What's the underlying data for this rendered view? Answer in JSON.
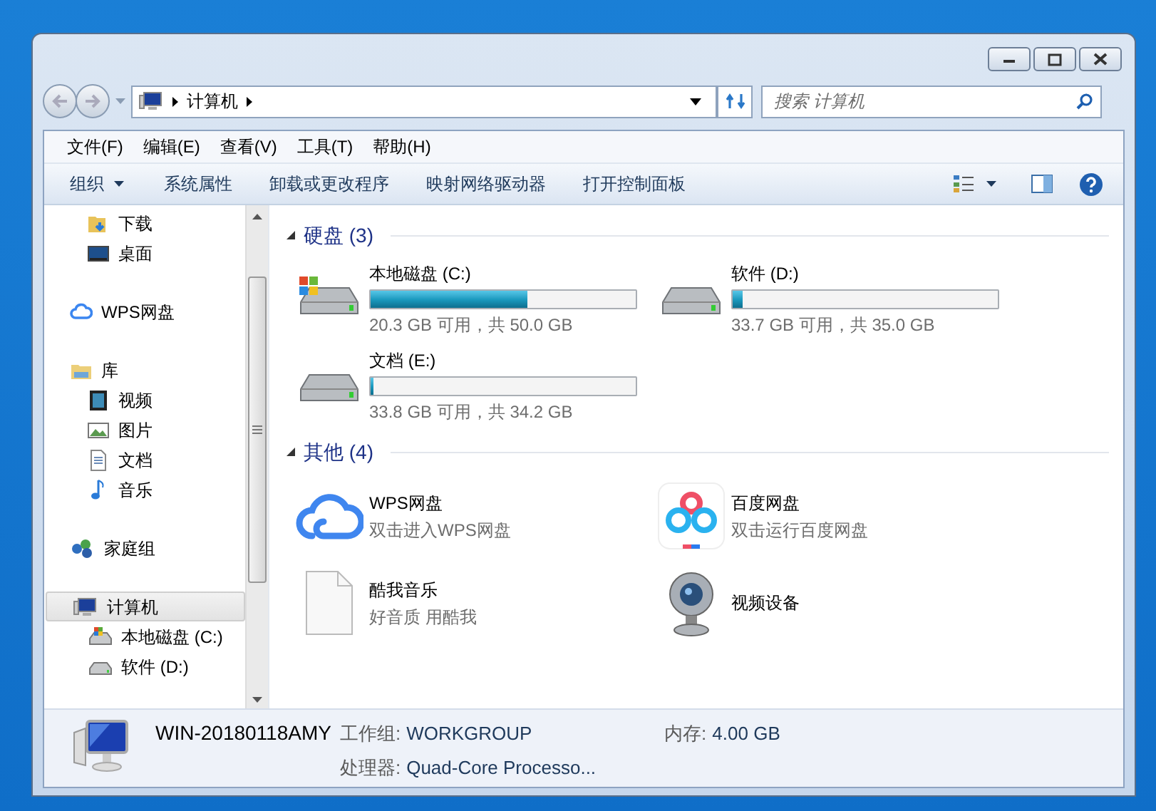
{
  "window": {
    "caption_buttons": [
      {
        "kind": "minimize"
      },
      {
        "kind": "maximize"
      },
      {
        "kind": "close"
      }
    ]
  },
  "navigation": {
    "address": [
      "计算机"
    ],
    "search": {
      "placeholder": "搜索 计算机"
    }
  },
  "menu": [
    "文件(F)",
    "编辑(E)",
    "查看(V)",
    "工具(T)",
    "帮助(H)"
  ],
  "toolbar": [
    {
      "label": "组织",
      "dropdown": true
    },
    {
      "label": "系统属性",
      "dropdown": false
    },
    {
      "label": "卸载或更改程序",
      "dropdown": false
    },
    {
      "label": "映射网络驱动器",
      "dropdown": false
    },
    {
      "label": "打开控制面板",
      "dropdown": false
    }
  ],
  "sidebar": [
    {
      "items": [
        {
          "label": "下载",
          "kind": "download",
          "selected": false
        },
        {
          "label": "桌面",
          "kind": "desktop",
          "selected": false
        }
      ]
    },
    {
      "head": {
        "label": "WPS网盘",
        "kind": "cloud",
        "selected": false
      }
    },
    {
      "head": {
        "label": "库",
        "kind": "library",
        "selected": false
      },
      "items": [
        {
          "label": "视频",
          "kind": "video",
          "selected": false
        },
        {
          "label": "图片",
          "kind": "picture",
          "selected": false
        },
        {
          "label": "文档",
          "kind": "document",
          "selected": false
        },
        {
          "label": "音乐",
          "kind": "music",
          "selected": false
        }
      ]
    },
    {
      "head": {
        "label": "家庭组",
        "kind": "homegroup",
        "selected": false
      }
    },
    {
      "head": {
        "label": "计算机",
        "kind": "computer",
        "selected": true
      },
      "items": [
        {
          "label": "本地磁盘 (C:)",
          "kind": "system-drive",
          "selected": false
        },
        {
          "label": "软件 (D:)",
          "kind": "drive",
          "selected": false
        }
      ]
    }
  ],
  "groups": [
    {
      "title": "硬盘 (3)",
      "expanded": true,
      "kind": "drives",
      "items": [
        {
          "name": "本地磁盘 (C:)",
          "kind": "system-drive",
          "level": 0.594,
          "free": "20.3 GB 可用，共 50.0 GB"
        },
        {
          "name": "软件 (D:)",
          "kind": "drive",
          "level": 0.037,
          "free": "33.7 GB 可用，共 35.0 GB"
        },
        {
          "name": "文档 (E:)",
          "kind": "drive",
          "level": 0.012,
          "free": "33.8 GB 可用，共 34.2 GB"
        }
      ]
    },
    {
      "title": "其他 (4)",
      "expanded": true,
      "kind": "others",
      "items": [
        {
          "name": "WPS网盘",
          "kind": "cloud",
          "subtitle": "双击进入WPS网盘"
        },
        {
          "name": "百度网盘",
          "kind": "baidu",
          "subtitle": "双击运行百度网盘"
        },
        {
          "name": "酷我音乐",
          "kind": "file",
          "subtitle": "好音质 用酷我"
        },
        {
          "name": "视频设备",
          "kind": "webcam"
        }
      ]
    }
  ],
  "details": {
    "name": "WIN-20180118AMY",
    "fields": [
      {
        "label": "工作组:",
        "value": "WORKGROUP"
      },
      {
        "label": "内存:",
        "value": "4.00 GB"
      },
      {
        "label": "处理器:",
        "value": "Quad-Core Processo..."
      }
    ]
  }
}
